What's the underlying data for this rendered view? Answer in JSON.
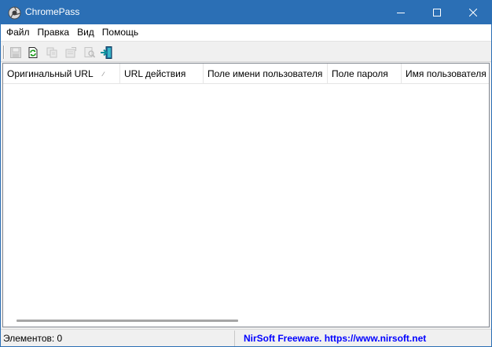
{
  "window": {
    "title": "ChromePass",
    "icon": "chromepass-app-icon",
    "controls": [
      "minimize-icon",
      "maximize-icon",
      "close-icon"
    ]
  },
  "menu": {
    "items": [
      {
        "label": "Файл"
      },
      {
        "label": "Правка"
      },
      {
        "label": "Вид"
      },
      {
        "label": "Помощь"
      }
    ]
  },
  "toolbar": {
    "buttons": [
      {
        "icon": "save-icon",
        "enabled": false
      },
      {
        "icon": "refresh-icon",
        "enabled": true
      },
      {
        "icon": "copy-icon",
        "enabled": false
      },
      {
        "icon": "properties-icon",
        "enabled": false
      },
      {
        "icon": "find-icon",
        "enabled": false
      },
      {
        "icon": "exit-icon",
        "enabled": true
      }
    ]
  },
  "table": {
    "columns": [
      {
        "label": "Оригинальный URL",
        "sorted": true
      },
      {
        "label": "URL действия"
      },
      {
        "label": "Поле имени пользователя"
      },
      {
        "label": "Поле пароля"
      },
      {
        "label": "Имя пользователя"
      }
    ],
    "rows": []
  },
  "status": {
    "items_count": "Элементов: 0",
    "link": "NirSoft Freeware. https://www.nirsoft.net"
  },
  "colors": {
    "titlebar": "#2b6fb5",
    "link": "#0000ff"
  }
}
